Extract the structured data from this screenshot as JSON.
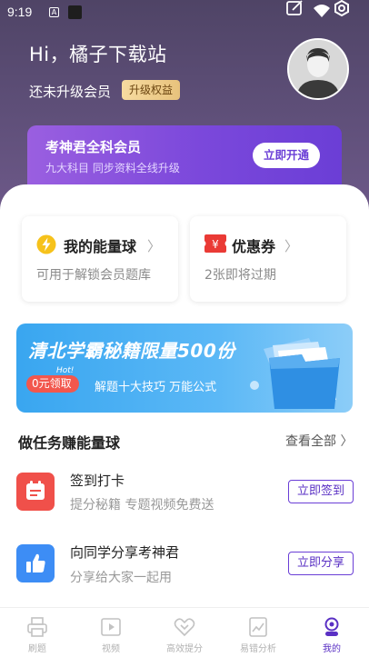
{
  "status_bar": {
    "time": "9:19",
    "a_badge": "A"
  },
  "header": {
    "greeting": "Hi，橘子下载站",
    "member_status": "还未升级会员",
    "upgrade_badge": "升级权益"
  },
  "vip_card": {
    "title": "考神君全科会员",
    "subtitle": "九大科目 同步资料全线升级",
    "button": "立即开通"
  },
  "features": [
    {
      "title": "我的能量球",
      "desc": "可用于解锁会员题库",
      "icon": "lightning-icon"
    },
    {
      "title": "优惠券",
      "desc": "2张即将过期",
      "icon": "coupon-icon"
    }
  ],
  "banner": {
    "title": "清北学霸秘籍限量500份",
    "hot": "Hot!",
    "pill": "0元领取",
    "subtitle": "解题十大技巧 万能公式"
  },
  "tasks": {
    "title": "做任务赚能量球",
    "see_all": "查看全部",
    "items": [
      {
        "name": "签到打卡",
        "desc": "提分秘籍 专题视频免费送",
        "button": "立即签到",
        "color": "#f0504a"
      },
      {
        "name": "向同学分享考神君",
        "desc": "分享给大家一起用",
        "button": "立即分享",
        "color": "#3d8df5"
      }
    ]
  },
  "tab_bar": {
    "items": [
      {
        "label": "刷题",
        "icon": "printer-icon"
      },
      {
        "label": "视频",
        "icon": "video-icon"
      },
      {
        "label": "高效提分",
        "icon": "heart-chevron-icon"
      },
      {
        "label": "易错分析",
        "icon": "analysis-icon"
      },
      {
        "label": "我的",
        "icon": "profile-icon",
        "active": true
      }
    ]
  },
  "colors": {
    "header": "#5d4e77",
    "accent": "#6a3ed6",
    "badge_gold": "#f2d296",
    "banner_blue": "#3fa8f2"
  }
}
